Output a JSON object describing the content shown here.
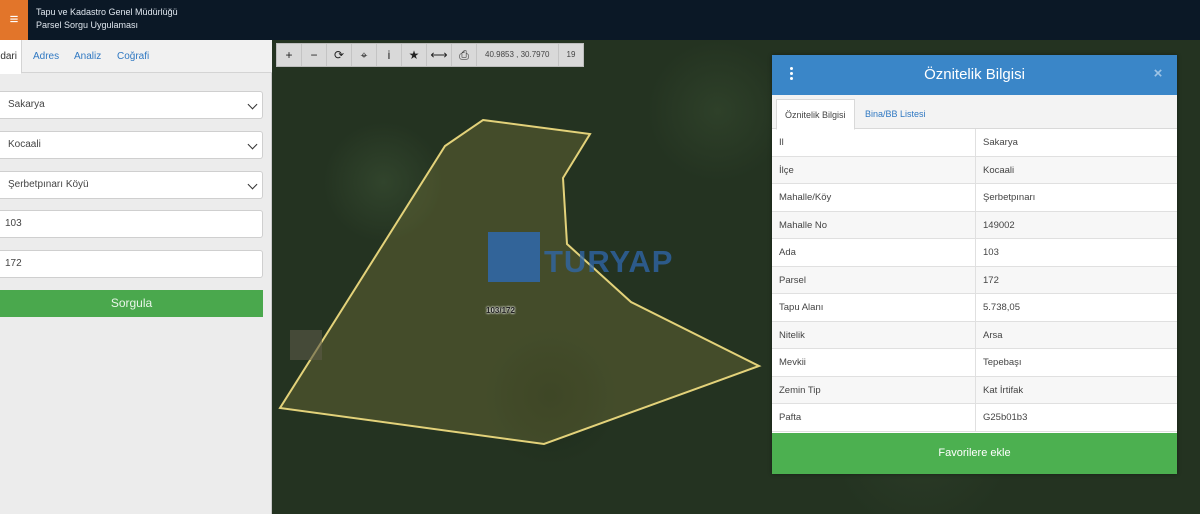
{
  "header": {
    "menu_icon": "hamburger-icon",
    "title_line1": "Tapu ve Kadastro Genel Müdürlüğü",
    "title_line2": "Parsel Sorgu Uygulaması"
  },
  "left_panel": {
    "tabs": [
      {
        "label": "dari"
      },
      {
        "label": "Adres"
      },
      {
        "label": "Analiz"
      },
      {
        "label": "Coğrafi"
      }
    ],
    "il": "Sakarya",
    "ilce": "Kocaali",
    "mahalle": "Şerbetpınarı Köyü",
    "ada": "103",
    "parsel": "172",
    "query_button": "Sorgula"
  },
  "map": {
    "toolbar": {
      "zoom_in": "+",
      "zoom_out": "−",
      "refresh": "⟳",
      "locate": "⌖",
      "info": "i",
      "favorite": "★",
      "measure": "⟷",
      "print": "⎙"
    },
    "coordinates": "40.9853 , 30.7970",
    "zoom_level": "19",
    "parcel_label": "103/172",
    "watermark": "TURYAP",
    "parcel_color": "#e3d27a"
  },
  "info_panel": {
    "title": "Öznitelik Bilgisi",
    "close": "×",
    "tabs": [
      {
        "label": "Öznitelik Bilgisi"
      },
      {
        "label": "Bina/BB Listesi"
      }
    ],
    "rows": [
      {
        "key": "Il",
        "value": "Sakarya"
      },
      {
        "key": "İlçe",
        "value": "Kocaali"
      },
      {
        "key": "Mahalle/Köy",
        "value": "Şerbetpınarı"
      },
      {
        "key": "Mahalle No",
        "value": "149002"
      },
      {
        "key": "Ada",
        "value": "103"
      },
      {
        "key": "Parsel",
        "value": "172"
      },
      {
        "key": "Tapu Alanı",
        "value": "5.738,05"
      },
      {
        "key": "Nitelik",
        "value": "Arsa"
      },
      {
        "key": "Mevkii",
        "value": "Tepebaşı"
      },
      {
        "key": "Zemin Tip",
        "value": "Kat İrtifak"
      },
      {
        "key": "Pafta",
        "value": "G25b01b3"
      }
    ],
    "favorite_button": "Favorilere ekle",
    "header_color": "#3a86c8",
    "button_color": "#4cb050"
  }
}
